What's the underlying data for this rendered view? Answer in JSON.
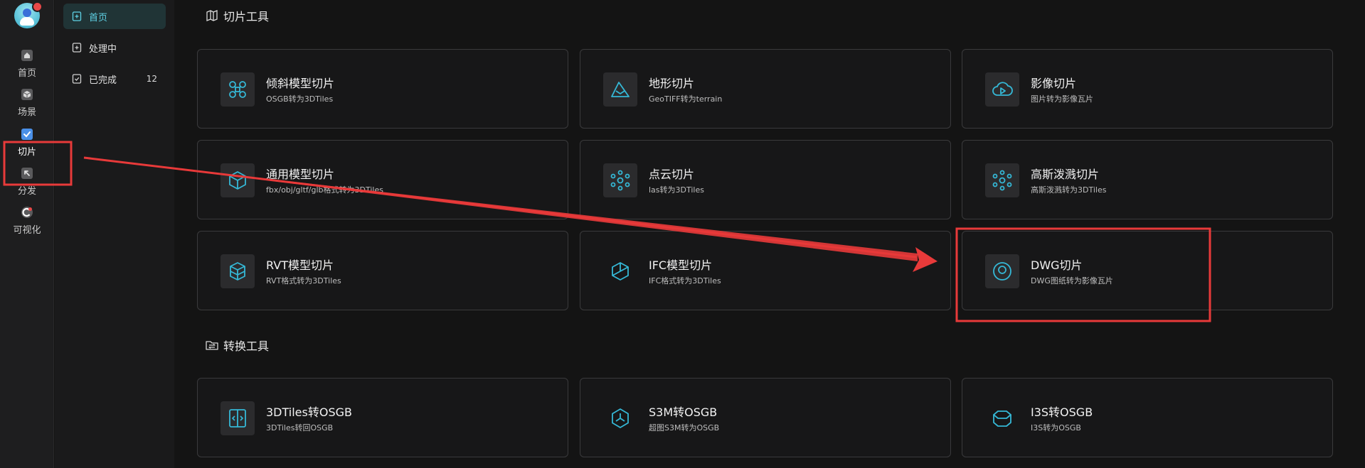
{
  "app": {
    "rail": [
      {
        "label": "首页",
        "icon": "home-icon"
      },
      {
        "label": "场景",
        "icon": "cube-icon"
      },
      {
        "label": "切片",
        "icon": "slice-icon"
      },
      {
        "label": "分发",
        "icon": "distribute-icon"
      },
      {
        "label": "可视化",
        "icon": "visualize-icon"
      }
    ],
    "submenu": [
      {
        "label": "首页",
        "icon": "page-add-icon",
        "active": true
      },
      {
        "label": "处理中",
        "icon": "page-add-icon"
      },
      {
        "label": "已完成",
        "icon": "page-check-icon",
        "count": "12"
      }
    ]
  },
  "sections": {
    "slice_tools": {
      "title": "切片工具",
      "icon": "map-icon",
      "cards": [
        {
          "title": "倾斜模型切片",
          "desc": "OSGB转为3DTiles",
          "icon": "drone-icon"
        },
        {
          "title": "地形切片",
          "desc": "GeoTIFF转为terrain",
          "icon": "mountain-icon"
        },
        {
          "title": "影像切片",
          "desc": "图片转为影像瓦片",
          "icon": "cloud-play-icon"
        },
        {
          "title": "通用模型切片",
          "desc": "fbx/obj/gltf/glb格式转为3DTiles",
          "icon": "box-icon"
        },
        {
          "title": "点云切片",
          "desc": "las转为3DTiles",
          "icon": "point-cloud-icon"
        },
        {
          "title": "高斯泼溅切片",
          "desc": "高斯泼溅转为3DTiles",
          "icon": "point-cloud-icon"
        },
        {
          "title": "RVT模型切片",
          "desc": "RVT格式转为3DTiles",
          "icon": "boxes-icon"
        },
        {
          "title": "IFC模型切片",
          "desc": "IFC格式转为3DTiles",
          "icon": "cube-outline-icon"
        },
        {
          "title": "DWG切片",
          "desc": "DWG图纸转为影像瓦片",
          "icon": "circle-icon"
        }
      ]
    },
    "convert_tools": {
      "title": "转换工具",
      "icon": "folder-swap-icon",
      "cards": [
        {
          "title": "3DTiles转OSGB",
          "desc": "3DTiles转回OSGB",
          "icon": "file-code-icon"
        },
        {
          "title": "S3M转OSGB",
          "desc": "超图S3M转为OSGB",
          "icon": "hexagon-icon"
        },
        {
          "title": "I3S转OSGB",
          "desc": "I3S转为OSGB",
          "icon": "package-icon"
        }
      ]
    }
  },
  "colors": {
    "accent": "#35b8d6",
    "annotation": "#e83a3a",
    "background": "#141414"
  }
}
